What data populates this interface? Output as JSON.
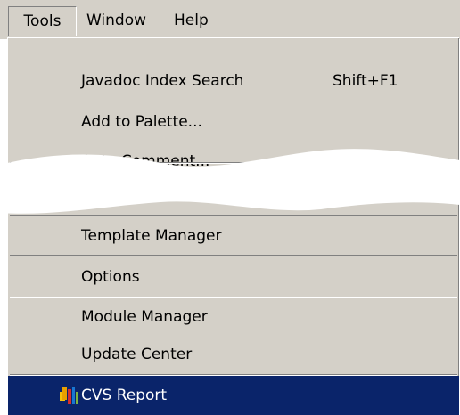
{
  "menubar": {
    "items": [
      {
        "label": "Tools"
      },
      {
        "label": "Window"
      },
      {
        "label": "Help"
      }
    ]
  },
  "menu": {
    "items": [
      {
        "label": "Javadoc Index Search",
        "shortcut": "Shift+F1"
      },
      {
        "label": "Add to Palette..."
      },
      {
        "label": "Auto Comment..."
      },
      {
        "label": "Template Manager"
      },
      {
        "label": "Options"
      },
      {
        "label": "Module Manager"
      },
      {
        "label": "Update Center"
      },
      {
        "label": "CVS Report",
        "icon": "cvs-report-icon",
        "highlighted": true
      }
    ]
  },
  "colors": {
    "menu_background": "#d4d0c8",
    "highlight_background": "#0a246a",
    "highlight_text": "#ffffff"
  }
}
